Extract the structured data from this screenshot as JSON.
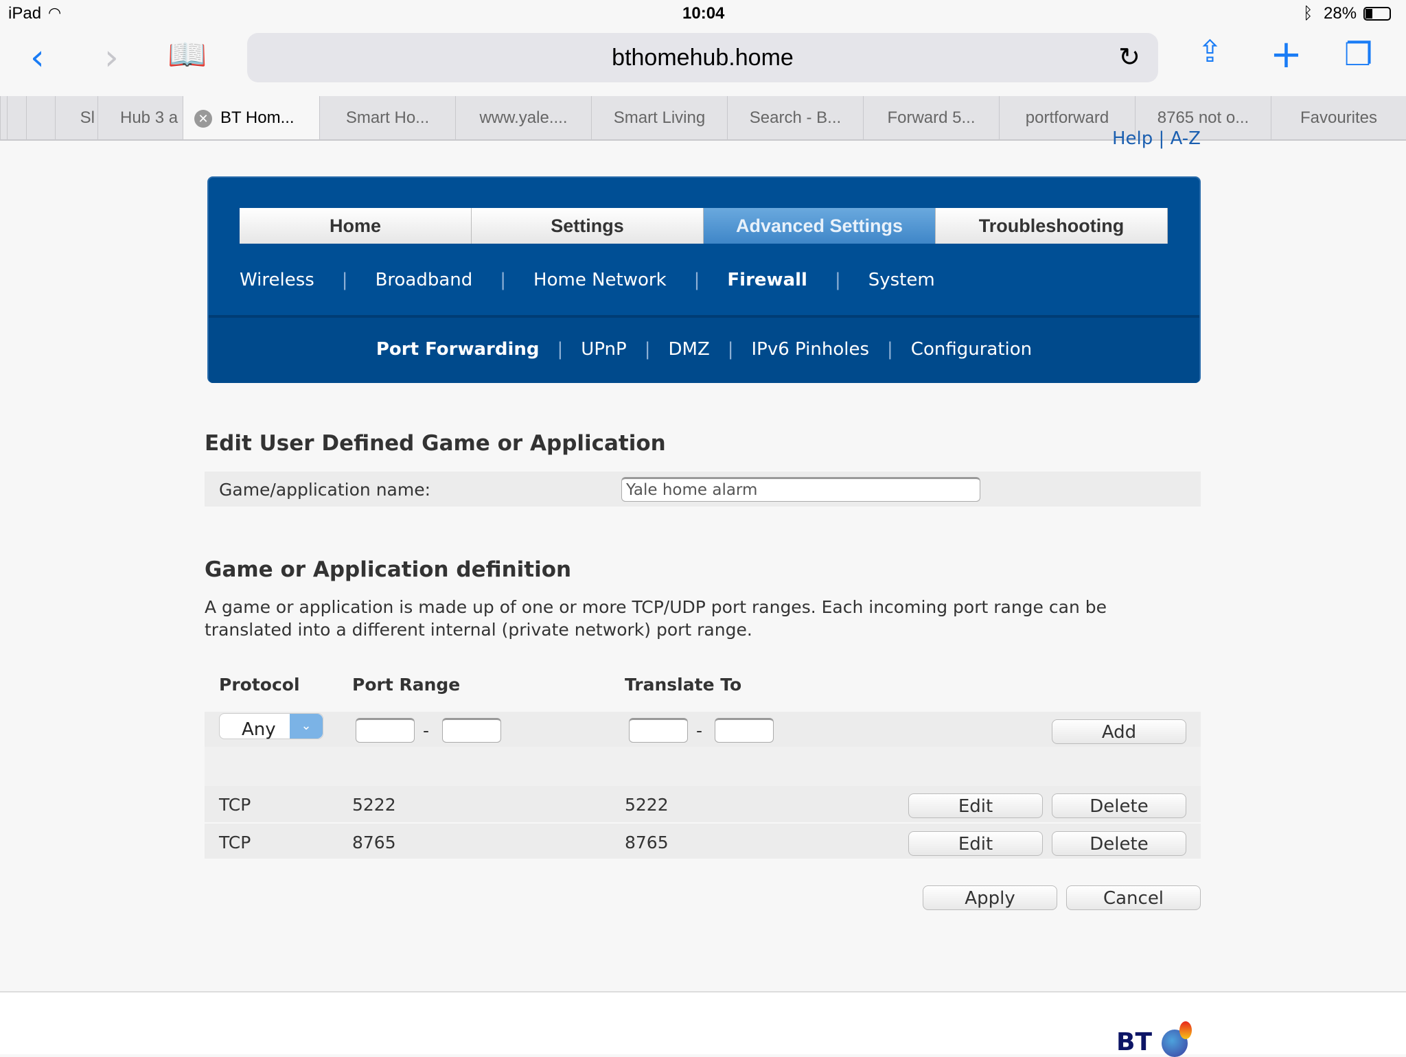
{
  "status_bar": {
    "device": "iPad",
    "time": "10:04",
    "battery": "28%"
  },
  "browser": {
    "url": "bthomehub.home",
    "tabs": [
      {
        "label": "Sl"
      },
      {
        "label": "Hub 3 a"
      },
      {
        "label": "BT Hom...",
        "active": true
      },
      {
        "label": "Smart Ho..."
      },
      {
        "label": "www.yale...."
      },
      {
        "label": "Smart Living"
      },
      {
        "label": "Search - B..."
      },
      {
        "label": "Forward 5..."
      },
      {
        "label": "portforward"
      },
      {
        "label": "8765 not o..."
      },
      {
        "label": "Favourites"
      }
    ]
  },
  "header": {
    "help": "Help",
    "az": "A-Z",
    "sep": "|"
  },
  "main_tabs": [
    "Home",
    "Settings",
    "Advanced Settings",
    "Troubleshooting"
  ],
  "sub_nav": [
    "Wireless",
    "Broadband",
    "Home Network",
    "Firewall",
    "System"
  ],
  "sub_sub_nav": [
    "Port Forwarding",
    "UPnP",
    "DMZ",
    "IPv6 Pinholes",
    "Configuration"
  ],
  "edit": {
    "title": "Edit User Defined Game or Application",
    "name_label": "Game/application name:",
    "name_value": "Yale home alarm"
  },
  "definition": {
    "title": "Game or Application definition",
    "desc1": "A game or application is made up of one or more TCP/UDP port ranges. Each incoming port range can be",
    "desc2": "translated into a different internal (private network) port range.",
    "col_protocol": "Protocol",
    "col_port_range": "Port Range",
    "col_translate": "Translate To",
    "protocol_value": "Any",
    "dash": "-",
    "add": "Add",
    "rows": [
      {
        "protocol": "TCP",
        "port": "5222",
        "translate": "5222"
      },
      {
        "protocol": "TCP",
        "port": "8765",
        "translate": "8765"
      }
    ],
    "edit_label": "Edit",
    "delete_label": "Delete"
  },
  "actions": {
    "apply": "Apply",
    "cancel": "Cancel"
  },
  "logo": "BT",
  "colors": {
    "nav_blue": "#004f95",
    "active_tab": "#4a8fd0",
    "ios_blue": "#1a7cf5"
  }
}
